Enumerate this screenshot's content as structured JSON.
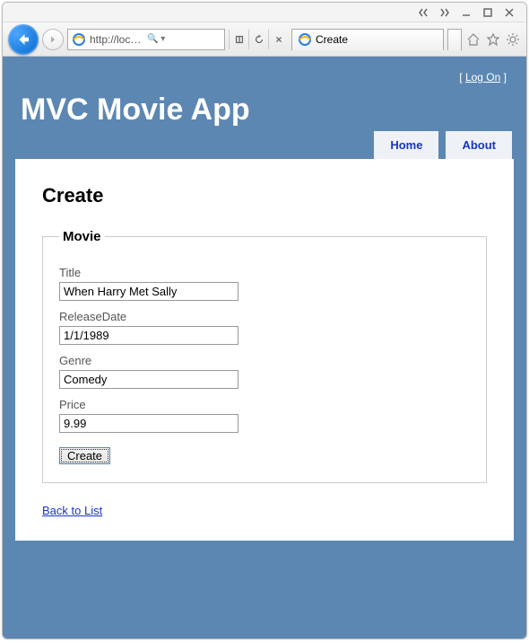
{
  "window": {
    "title_btns": {}
  },
  "browser": {
    "address": "http://loc…",
    "tab_title": "Create"
  },
  "header": {
    "log_on_label": "Log On",
    "app_title": "MVC Movie App",
    "menu": {
      "home": "Home",
      "about": "About"
    }
  },
  "page": {
    "heading": "Create",
    "legend": "Movie",
    "fields": {
      "title_label": "Title",
      "title_value": "When Harry Met Sally",
      "releasedate_label": "ReleaseDate",
      "releasedate_value": "1/1/1989",
      "genre_label": "Genre",
      "genre_value": "Comedy",
      "price_label": "Price",
      "price_value": "9.99"
    },
    "submit_label": "Create",
    "back_link": "Back to List"
  }
}
